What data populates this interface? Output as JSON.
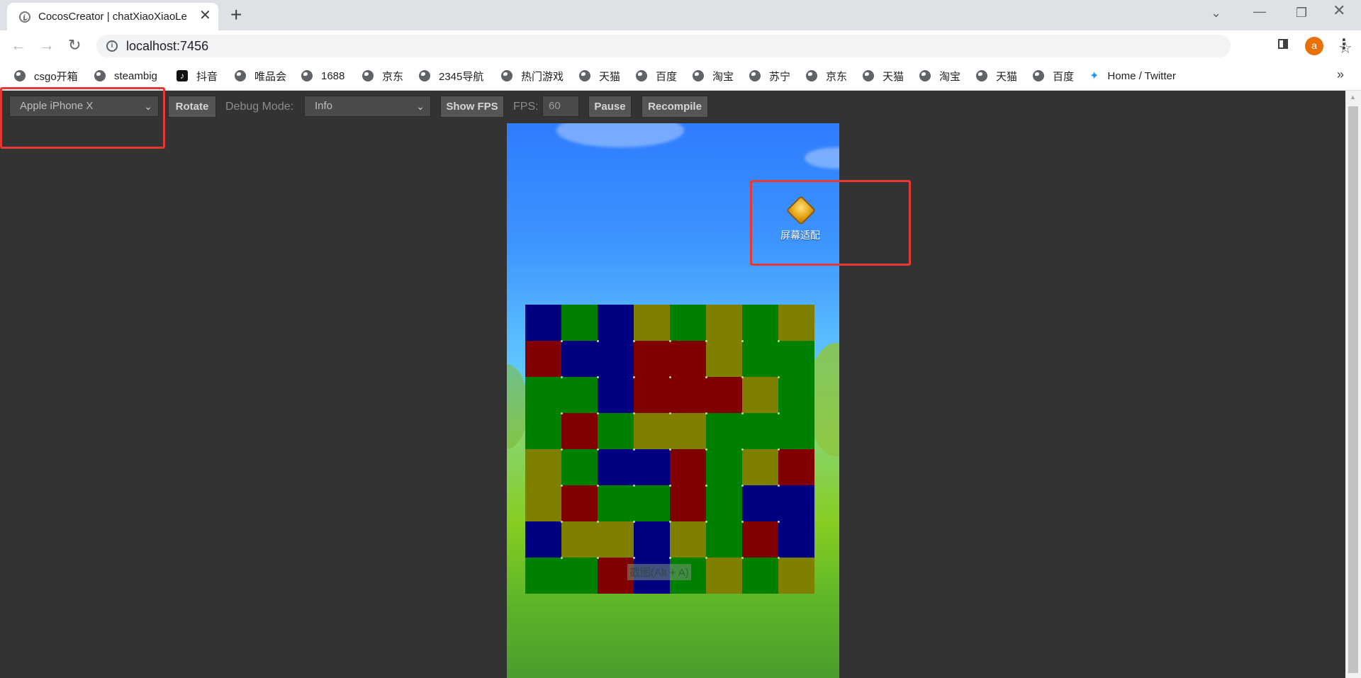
{
  "browser": {
    "tab_title": "CocosCreator | chatXiaoXiaoLe",
    "tab_close": "✕",
    "new_tab": "+",
    "url": "localhost:7456",
    "avatar_letter": "a",
    "bookmarks": [
      {
        "label": "csgo开箱",
        "icon": "globe-icon"
      },
      {
        "label": "steambig",
        "icon": "globe-icon"
      },
      {
        "label": "抖音",
        "icon": "tiktok-icon"
      },
      {
        "label": "唯品会",
        "icon": "globe-icon"
      },
      {
        "label": "1688",
        "icon": "globe-icon"
      },
      {
        "label": "京东",
        "icon": "globe-icon"
      },
      {
        "label": "2345导航",
        "icon": "globe-icon"
      },
      {
        "label": "热门游戏",
        "icon": "globe-icon"
      },
      {
        "label": "天猫",
        "icon": "globe-icon"
      },
      {
        "label": "百度",
        "icon": "globe-icon"
      },
      {
        "label": "淘宝",
        "icon": "globe-icon"
      },
      {
        "label": "苏宁",
        "icon": "globe-icon"
      },
      {
        "label": "京东",
        "icon": "globe-icon"
      },
      {
        "label": "天猫",
        "icon": "globe-icon"
      },
      {
        "label": "淘宝",
        "icon": "globe-icon"
      },
      {
        "label": "天猫",
        "icon": "globe-icon"
      },
      {
        "label": "百度",
        "icon": "globe-icon"
      },
      {
        "label": "Home / Twitter",
        "icon": "twitter-icon"
      }
    ],
    "bookmarks_more": "»"
  },
  "preview_toolbar": {
    "device": "Apple iPhone X",
    "rotate_label": "Rotate",
    "debug_mode_label": "Debug Mode:",
    "debug_mode_value": "Info",
    "show_fps_label": "Show FPS",
    "fps_label": "FPS:",
    "fps_value": "60",
    "pause_label": "Pause",
    "recompile_label": "Recompile"
  },
  "game": {
    "screen_adapt_label": "屏幕适配",
    "screenshot_hint": "截图(Alt + A)",
    "colors": {
      "B": "#000080",
      "G": "#008000",
      "R": "#800000",
      "Y": "#808000"
    },
    "board": [
      [
        "B",
        "G",
        "B",
        "Y",
        "G",
        "Y",
        "G",
        "Y"
      ],
      [
        "R",
        "B",
        "B",
        "R",
        "R",
        "Y",
        "G",
        "G"
      ],
      [
        "G",
        "G",
        "B",
        "R",
        "R",
        "R",
        "Y",
        "G"
      ],
      [
        "G",
        "R",
        "G",
        "Y",
        "Y",
        "G",
        "G",
        "G"
      ],
      [
        "Y",
        "G",
        "B",
        "B",
        "R",
        "G",
        "Y",
        "R"
      ],
      [
        "Y",
        "R",
        "G",
        "G",
        "R",
        "G",
        "B",
        "B"
      ],
      [
        "B",
        "Y",
        "Y",
        "B",
        "Y",
        "G",
        "R",
        "B"
      ],
      [
        "G",
        "G",
        "R",
        "B",
        "G",
        "Y",
        "G",
        "Y"
      ]
    ]
  }
}
